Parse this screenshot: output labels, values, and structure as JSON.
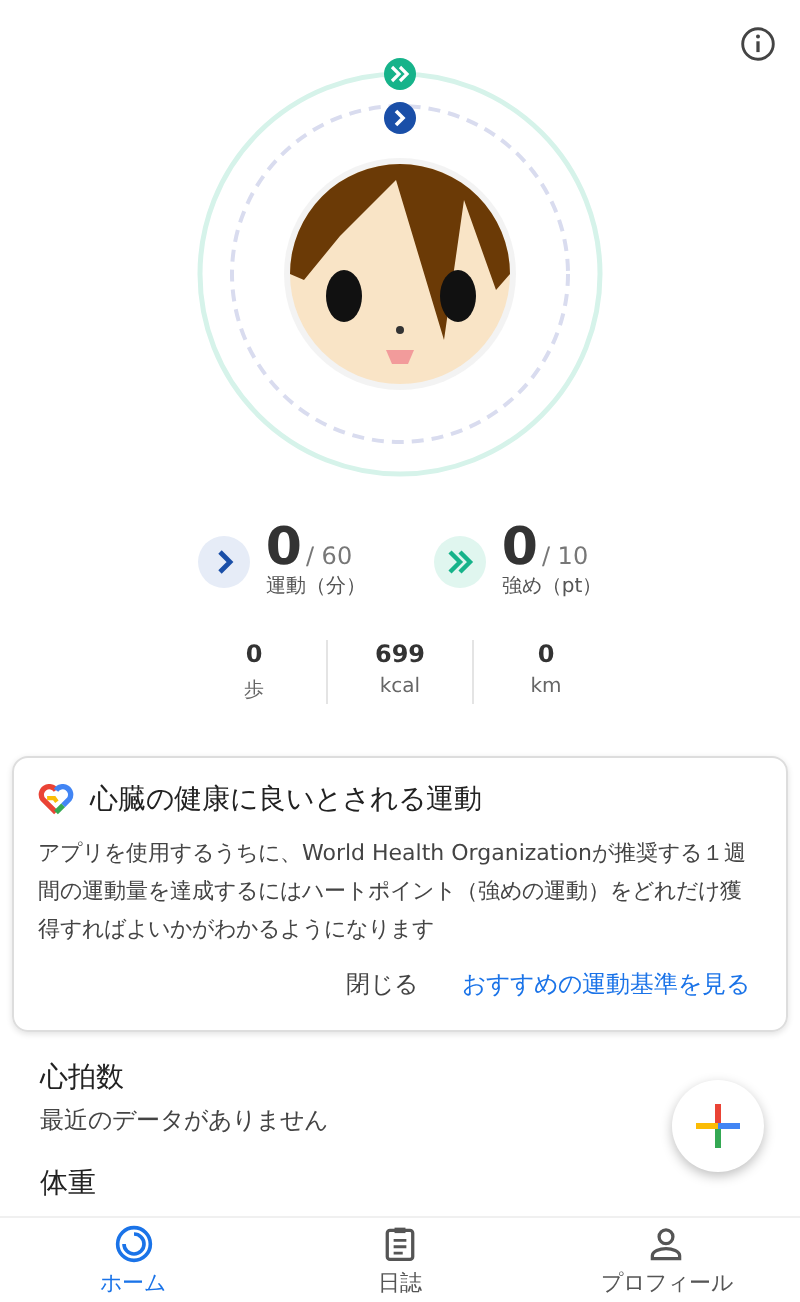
{
  "goals": [
    {
      "kind": "move",
      "value": "0",
      "target": "/ 60",
      "label": "運動（分）"
    },
    {
      "kind": "heart",
      "value": "0",
      "target": "/ 10",
      "label": "強め（pt）"
    }
  ],
  "stats": [
    {
      "value": "0",
      "unit": "歩"
    },
    {
      "value": "699",
      "unit": "kcal"
    },
    {
      "value": "0",
      "unit": "km"
    }
  ],
  "card": {
    "title": "心臓の健康に良いとされる運動",
    "body": "アプリを使用するうちに、World Health Organizationが推奨する１週間の運動量を達成するにはハートポイント（強めの運動）をどれだけ獲得すればよいかがわかるようになります",
    "buttons": [
      {
        "label": "閉じる",
        "kind": "text"
      },
      {
        "label": "おすすめの運動基準を見る",
        "kind": "primary"
      }
    ]
  },
  "metrics": [
    {
      "title": "心拍数",
      "value": "最近のデータがありません"
    },
    {
      "title": "体重"
    }
  ],
  "nav": [
    {
      "label": "ホーム",
      "selected": true,
      "kind": "home"
    },
    {
      "label": "日誌",
      "selected": false,
      "kind": "journal"
    },
    {
      "label": "プロフィール",
      "selected": false,
      "kind": "profile"
    }
  ]
}
